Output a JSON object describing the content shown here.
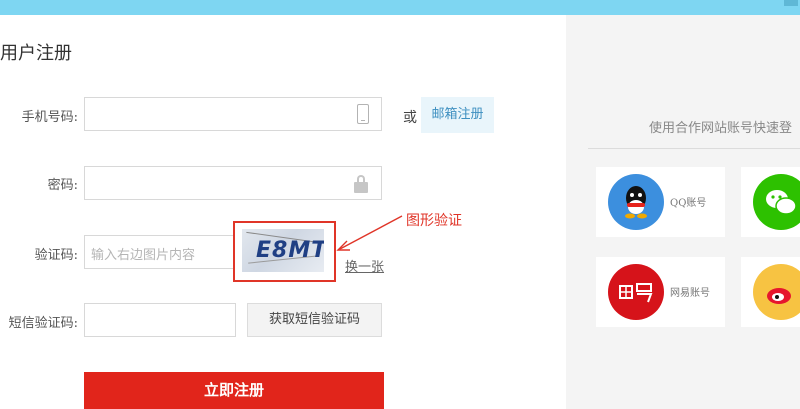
{
  "page": {
    "title": "用户注册"
  },
  "form": {
    "phone_label": "手机号码:",
    "password_label": "密码:",
    "captcha_label": "验证码:",
    "captcha_placeholder": "输入右边图片内容",
    "captcha_image_text": "E8MT",
    "refresh_link": "换一张",
    "sms_label": "短信验证码:",
    "sms_button": "获取短信验证码",
    "submit_button": "立即注册",
    "or_text": "或",
    "email_register": "邮箱注册"
  },
  "annotation": {
    "text": "图形验证",
    "color": "#e03528"
  },
  "social": {
    "title": "使用合作网站账号快速登",
    "tiles": [
      {
        "label": "QQ账号",
        "icon": "qq-icon",
        "color": "#3c8fde"
      },
      {
        "label": "",
        "icon": "wechat-icon",
        "color": "#2dc100"
      },
      {
        "label": "网易账号",
        "icon": "netease-icon",
        "color": "#d6131a"
      },
      {
        "label": "",
        "icon": "weibo-icon",
        "color": "#f7c342"
      }
    ]
  },
  "colors": {
    "topbar": "#7ed6f2",
    "submit": "#e1251b",
    "link": "#3d8fc0"
  }
}
